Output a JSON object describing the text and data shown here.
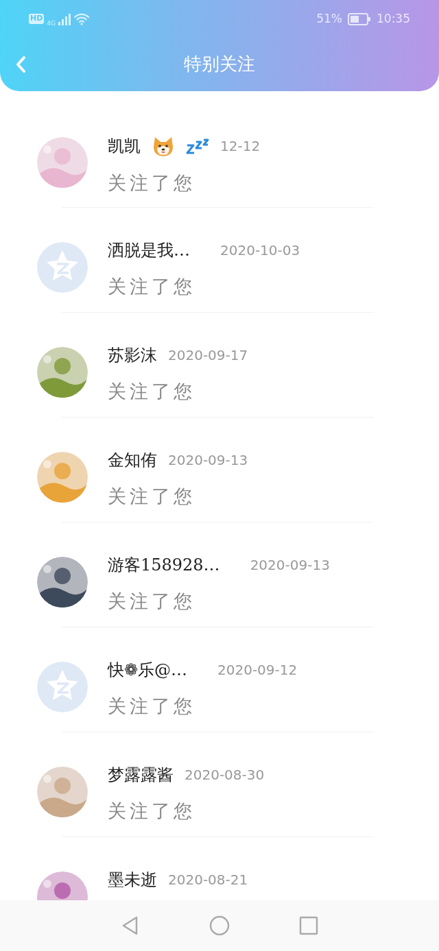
{
  "status_bar": {
    "hd": "HD",
    "network": "4G",
    "battery": "51%",
    "time": "10:35"
  },
  "header": {
    "title": "特别关注"
  },
  "items": [
    {
      "name": "凯凯",
      "emoji_icons": [
        {
          "kind": "dog"
        },
        {
          "kind": "zzz"
        }
      ],
      "date": "12-12",
      "note": "关注了您"
    },
    {
      "avatar": {
        "kind": "default"
      },
      "name": "洒脱是我…",
      "date": "2020-10-03",
      "note": "关注了您"
    },
    {
      "name": "苏影沫",
      "date": "2020-09-17",
      "note": "关注了您"
    },
    {
      "name": "金知侑",
      "date": "2020-09-13",
      "note": "关注了您"
    },
    {
      "name": "游客158928…",
      "date": "2020-09-13",
      "note": "关注了您"
    },
    {
      "avatar": {
        "kind": "default"
      },
      "name": "快❁乐@…",
      "date": "2020-09-12",
      "note": "关注了您"
    },
    {
      "name": "梦露露酱",
      "date": "2020-08-30",
      "note": "关注了您"
    },
    {
      "name": "墨未逝",
      "date": "2020-08-21"
    }
  ]
}
